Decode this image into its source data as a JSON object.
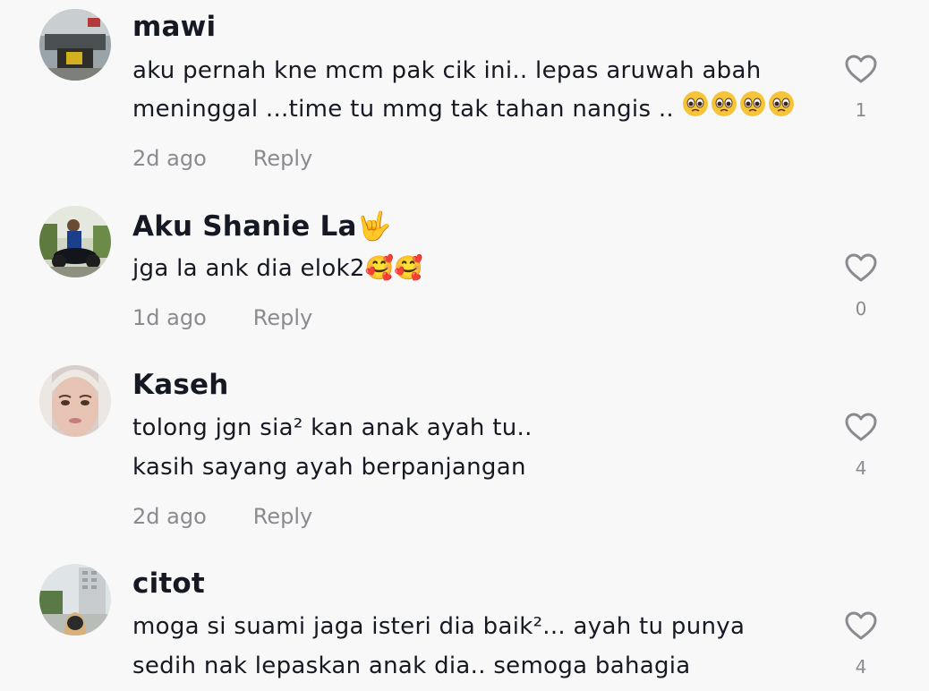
{
  "comments": [
    {
      "username": "mawi",
      "lines": [
        "aku pernah kne mcm pak cik ini.. lepas aruwah abah",
        "meninggal ...time tu mmg tak tahan nangis .. 🥺🥺🥺🥺"
      ],
      "time": "2d ago",
      "reply_label": "Reply",
      "likes": "1"
    },
    {
      "username": "Aku Shanie La🤟",
      "lines": [
        "jga la ank dia elok2🥰🥰"
      ],
      "time": "1d ago",
      "reply_label": "Reply",
      "likes": "0"
    },
    {
      "username": "Kaseh",
      "lines": [
        "tolong jgn sia² kan anak ayah tu..",
        "kasih sayang ayah berpanjangan"
      ],
      "time": "2d ago",
      "reply_label": "Reply",
      "likes": "4"
    },
    {
      "username": "citot",
      "lines": [
        "moga si suami jaga isteri dia baik²... ayah tu punya",
        "sedih nak lepaskan anak dia.. semoga bahagia"
      ],
      "likes": "4"
    }
  ],
  "icons": {
    "like": "heart-outline-icon",
    "emoji_pleading": "pleading-face-emoji",
    "emoji_hearts": "smiling-face-with-hearts-emoji",
    "emoji_rock": "love-you-gesture-emoji"
  },
  "colors": {
    "background": "#f8f8f8",
    "username": "#161823",
    "meta": "#8a8b91",
    "heart_stroke": "#8a8b91"
  }
}
